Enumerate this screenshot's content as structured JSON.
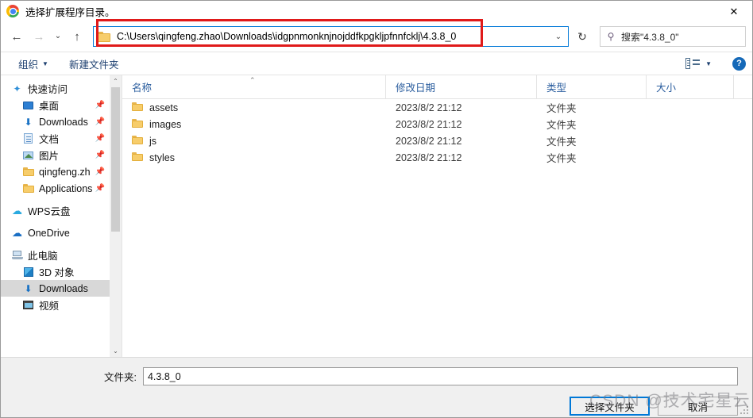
{
  "window": {
    "title": "选择扩展程序目录。",
    "app_icon": "chrome-icon",
    "close_label": "✕"
  },
  "nav": {
    "back_icon": "←",
    "forward_icon": "→",
    "recent_icon": "⌄",
    "up_icon": "↑",
    "refresh_icon": "↻",
    "address_path": "C:\\Users\\qingfeng.zhao\\Downloads\\idgpnmonknjnojddfkpgkljpfnnfcklj\\4.3.8_0",
    "address_chevron": "⌄",
    "search_icon": "search-icon",
    "search_placeholder": "搜索\"4.3.8_0\""
  },
  "commandbar": {
    "organize_label": "组织",
    "organize_caret": "▼",
    "new_folder_label": "新建文件夹",
    "view_caret": "▼",
    "help_label": "?"
  },
  "sidebar": {
    "groups": [
      {
        "items": [
          {
            "label": "快速访问",
            "icon": "star-icon",
            "level": 0,
            "pinned": false,
            "selected": false
          },
          {
            "label": "桌面",
            "icon": "desktop-icon",
            "level": 1,
            "pinned": true,
            "selected": false
          },
          {
            "label": "Downloads",
            "icon": "download-icon",
            "level": 1,
            "pinned": true,
            "selected": false
          },
          {
            "label": "文档",
            "icon": "document-icon",
            "level": 1,
            "pinned": true,
            "selected": false
          },
          {
            "label": "图片",
            "icon": "pictures-icon",
            "level": 1,
            "pinned": true,
            "selected": false
          },
          {
            "label": "qingfeng.zh",
            "icon": "folder-icon",
            "level": 1,
            "pinned": true,
            "selected": false
          },
          {
            "label": "Applications",
            "icon": "folder-icon",
            "level": 1,
            "pinned": true,
            "selected": false
          }
        ]
      },
      {
        "items": [
          {
            "label": "WPS云盘",
            "icon": "cloud-wps-icon",
            "level": 0,
            "pinned": false,
            "selected": false
          }
        ]
      },
      {
        "items": [
          {
            "label": "OneDrive",
            "icon": "cloud-onedrive-icon",
            "level": 0,
            "pinned": false,
            "selected": false
          }
        ]
      },
      {
        "items": [
          {
            "label": "此电脑",
            "icon": "this-pc-icon",
            "level": 0,
            "pinned": false,
            "selected": false
          },
          {
            "label": "3D 对象",
            "icon": "3d-objects-icon",
            "level": 1,
            "pinned": false,
            "selected": false
          },
          {
            "label": "Downloads",
            "icon": "download-icon",
            "level": 1,
            "pinned": false,
            "selected": true
          },
          {
            "label": "视频",
            "icon": "videos-icon",
            "level": 1,
            "pinned": false,
            "selected": false
          }
        ]
      }
    ],
    "scroll_up_icon": "⌃",
    "scroll_down_icon": "⌄"
  },
  "filelist": {
    "columns": [
      {
        "label": "名称",
        "key": "name"
      },
      {
        "label": "修改日期",
        "key": "date"
      },
      {
        "label": "类型",
        "key": "type"
      },
      {
        "label": "大小",
        "key": "size"
      }
    ],
    "sort_indicator": "⌃",
    "rows": [
      {
        "name": "assets",
        "date": "2023/8/2 21:12",
        "type": "文件夹",
        "size": ""
      },
      {
        "name": "images",
        "date": "2023/8/2 21:12",
        "type": "文件夹",
        "size": ""
      },
      {
        "name": "js",
        "date": "2023/8/2 21:12",
        "type": "文件夹",
        "size": ""
      },
      {
        "name": "styles",
        "date": "2023/8/2 21:12",
        "type": "文件夹",
        "size": ""
      }
    ]
  },
  "footer": {
    "folder_label": "文件夹:",
    "folder_value": "4.3.8_0",
    "select_button": "选择文件夹",
    "cancel_button": "取消"
  },
  "annotation": {
    "highlight_color": "#e01a1a"
  },
  "watermark": {
    "text": "CSDN @技术宅星云"
  }
}
